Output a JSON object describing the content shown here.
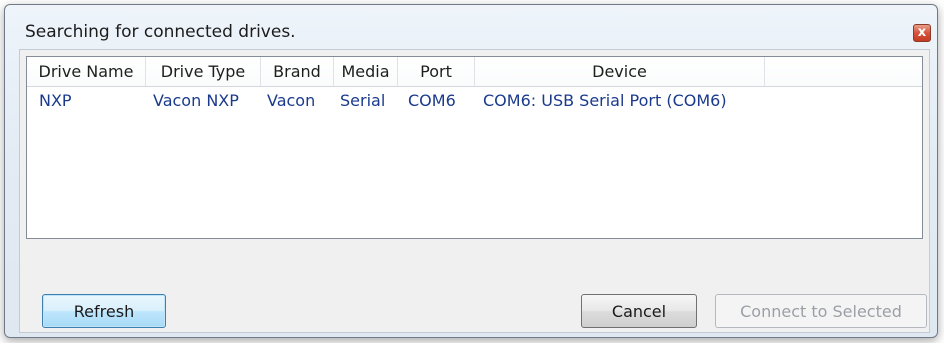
{
  "window": {
    "title": "Searching for connected drives.",
    "close_symbol": "x",
    "close_icon": "close-icon"
  },
  "drive_list": {
    "columns": [
      "Drive Name",
      "Drive Type",
      "Brand",
      "Media",
      "Port",
      "Device"
    ],
    "rows": [
      [
        "NXP",
        "Vacon NXP",
        "Vacon",
        "Serial",
        "COM6",
        "COM6: USB Serial Port (COM6)"
      ]
    ]
  },
  "buttons": {
    "refresh": "Refresh",
    "cancel": "Cancel",
    "connect": "Connect to Selected"
  },
  "colors": {
    "row_text": "#1a3a8c",
    "close_button": "#c43c22",
    "default_button_border": "#3c7fb1"
  }
}
